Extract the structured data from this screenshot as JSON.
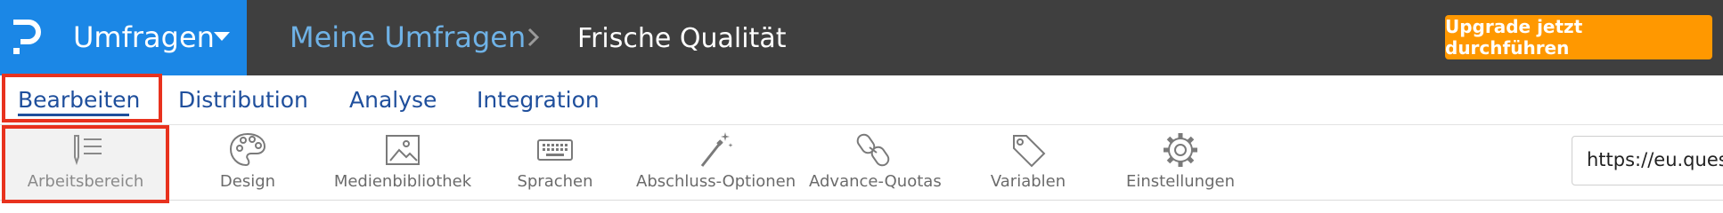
{
  "brand": {
    "name": "Umfragen",
    "icon": "p-logo-icon"
  },
  "breadcrumb": {
    "root": "Meine Umfragen",
    "current": "Frische Qualität"
  },
  "upgrade_label": "Upgrade jetzt durchführen",
  "tabs": [
    {
      "label": "Bearbeiten",
      "active": true
    },
    {
      "label": "Distribution"
    },
    {
      "label": "Analyse"
    },
    {
      "label": "Integration"
    }
  ],
  "toolbar": [
    {
      "label": "Arbeitsbereich",
      "icon": "pencil-list-icon",
      "active": true
    },
    {
      "label": "Design",
      "icon": "palette-icon"
    },
    {
      "label": "Medienbibliothek",
      "icon": "image-icon"
    },
    {
      "label": "Sprachen",
      "icon": "keyboard-icon"
    },
    {
      "label": "Abschluss-Optionen",
      "icon": "magic-wand-icon"
    },
    {
      "label": "Advance-Quotas",
      "icon": "chain-link-icon"
    },
    {
      "label": "Variablen",
      "icon": "tag-icon"
    },
    {
      "label": "Einstellungen",
      "icon": "gear-icon"
    }
  ],
  "survey_url": "https://eu.ques",
  "colors": {
    "brand_blue": "#1b87e6",
    "header_dark": "#3f3f3f",
    "upgrade_orange": "#ff9800",
    "tab_blue": "#1f4f9c",
    "highlight_red": "#e8321e"
  }
}
